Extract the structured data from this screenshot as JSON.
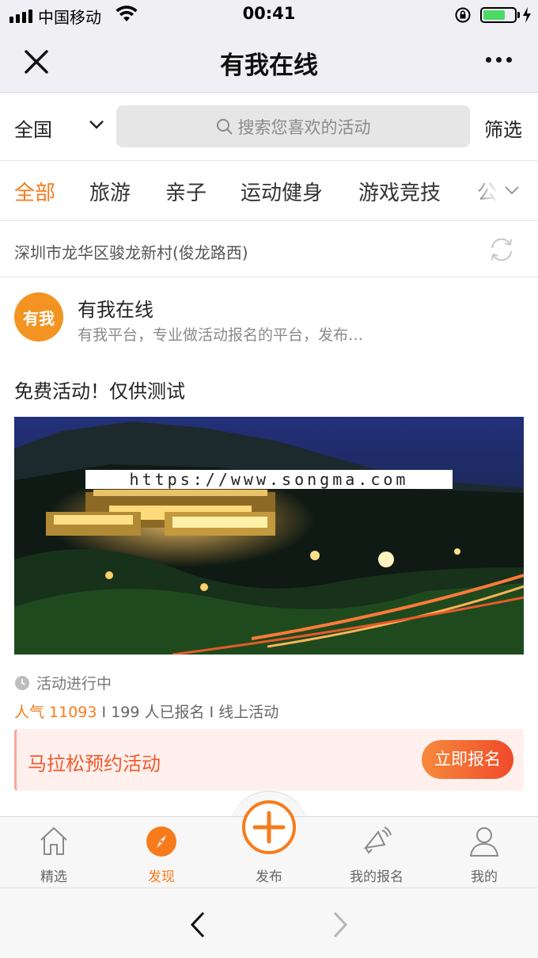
{
  "status_bar": {
    "carrier": "中国移动",
    "time": "00:41",
    "battery_level": 0.72
  },
  "nav": {
    "title": "有我在线"
  },
  "search": {
    "region": "全国",
    "placeholder": "搜索您喜欢的活动",
    "filter_label": "筛选"
  },
  "tabs": [
    "全部",
    "旅游",
    "亲子",
    "运动健身",
    "游戏竞技",
    "公"
  ],
  "location": {
    "address": "深圳市龙华区骏龙新村(俊龙路西)"
  },
  "organizer": {
    "logo_text": "有我",
    "name": "有我在线",
    "description": "有我平台，专业做活动报名的平台，发布…"
  },
  "activity": {
    "title": "免费活动！仅供测试",
    "watermark": "https://www.songma.com",
    "status": "活动进行中",
    "popularity_label": "人气 11093",
    "registered": "199 人已报名",
    "type": "线上活动",
    "separator": "I",
    "cta_title": "马拉松预约活动",
    "cta_button": "立即报名"
  },
  "tabbar": {
    "items": [
      {
        "label": "精选",
        "icon": "home-icon"
      },
      {
        "label": "发现",
        "icon": "compass-icon"
      },
      {
        "label": "发布",
        "icon": "plus-circle-icon"
      },
      {
        "label": "我的报名",
        "icon": "megaphone-icon"
      },
      {
        "label": "我的",
        "icon": "user-icon"
      }
    ],
    "active": "发现"
  },
  "colors": {
    "accent": "#f77b1c",
    "cta_red": "#f25a2a",
    "tab_bg": "#f7f7f7"
  }
}
